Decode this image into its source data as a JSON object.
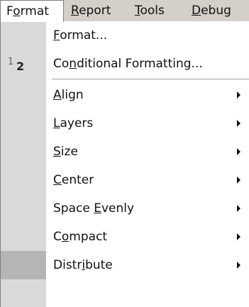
{
  "menubar": {
    "items": [
      {
        "label": "Format",
        "mnemonic_index": 1
      },
      {
        "label": "Report",
        "mnemonic_index": 0
      },
      {
        "label": "Tools",
        "mnemonic_index": 0
      },
      {
        "label": "Debug",
        "mnemonic_index": 0
      }
    ]
  },
  "menu": {
    "items": [
      {
        "label": "Format...",
        "mnemonic_index": 0,
        "submenu": false
      },
      {
        "label": "Conditional Formatting...",
        "mnemonic_index": 2,
        "submenu": false,
        "icon": {
          "name": "conditional-formatting-icon",
          "small": "1",
          "big": "2"
        }
      },
      {
        "label": "Align",
        "mnemonic_index": 0,
        "submenu": true
      },
      {
        "label": "Layers",
        "mnemonic_index": 0,
        "submenu": true
      },
      {
        "label": "Size",
        "mnemonic_index": 0,
        "submenu": true
      },
      {
        "label": "Center",
        "mnemonic_index": 0,
        "submenu": true
      },
      {
        "label": "Space Evenly",
        "mnemonic_index": 6,
        "submenu": true
      },
      {
        "label": "Compact",
        "mnemonic_index": 1,
        "submenu": true
      },
      {
        "label": "Distribute",
        "mnemonic_index": 5,
        "submenu": true
      }
    ]
  }
}
